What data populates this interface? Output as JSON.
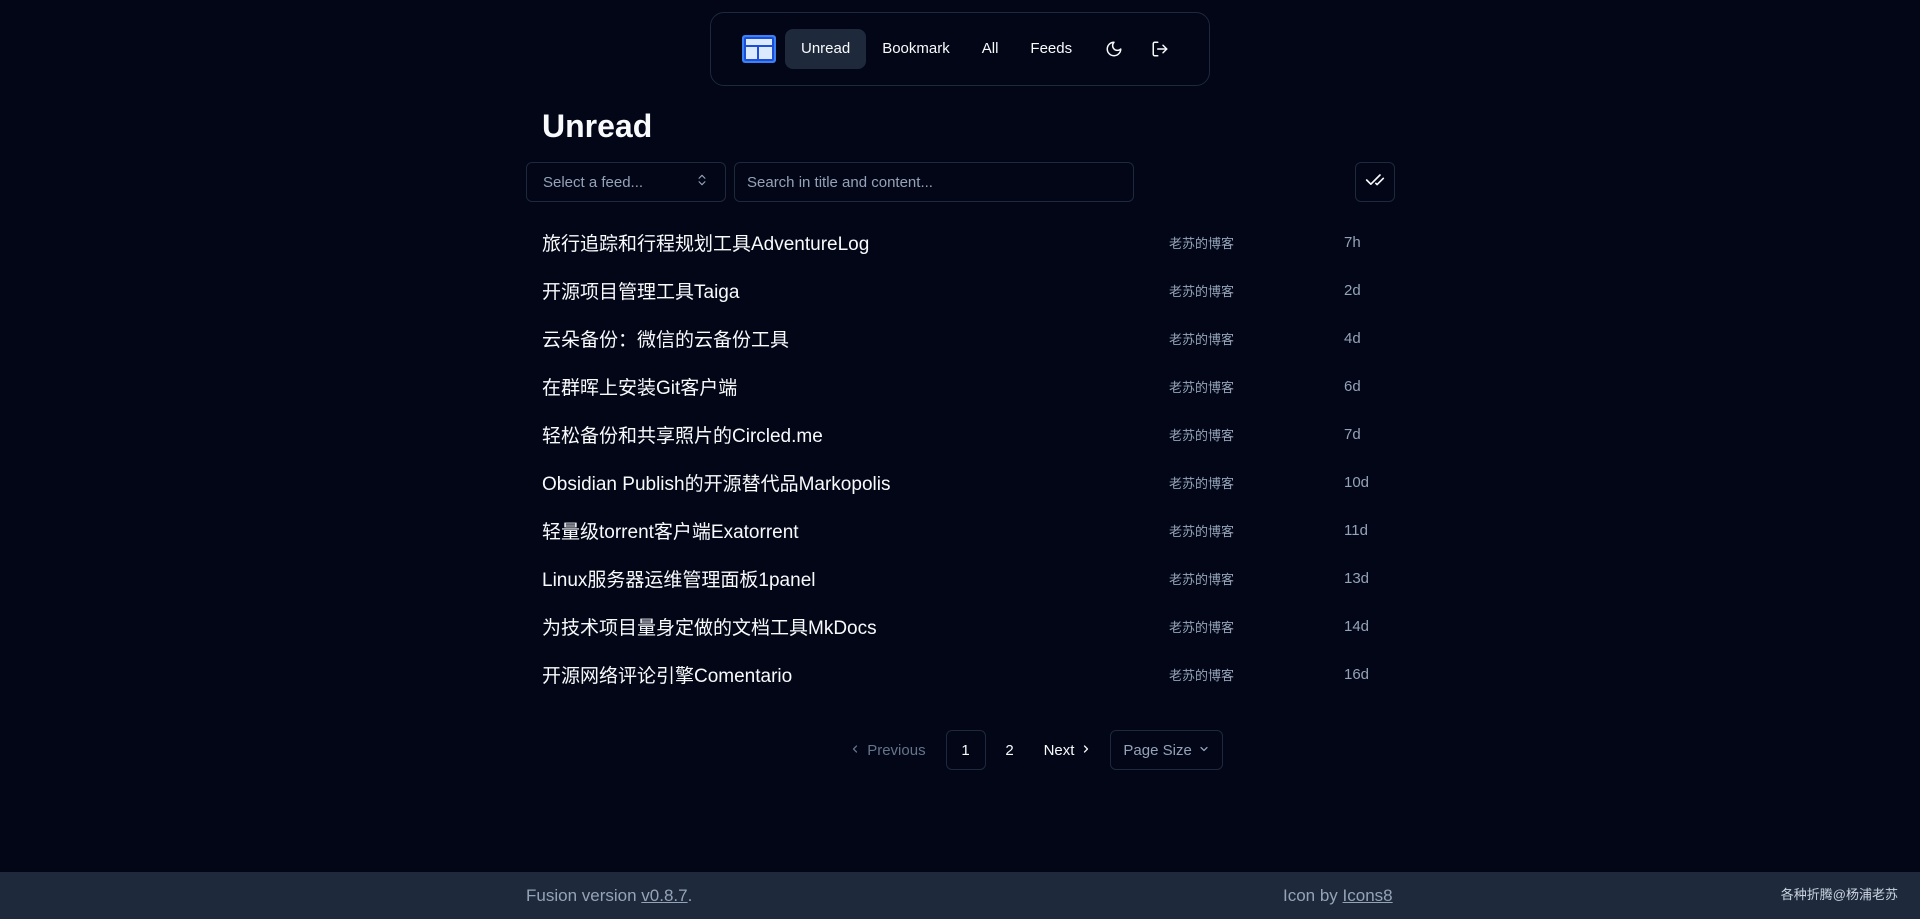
{
  "nav": {
    "items": [
      {
        "label": "Unread",
        "active": true
      },
      {
        "label": "Bookmark",
        "active": false
      },
      {
        "label": "All",
        "active": false
      },
      {
        "label": "Feeds",
        "active": false
      }
    ],
    "theme_icon": "moon-icon",
    "logout_icon": "logout-icon",
    "logo_icon": "app-logo-icon"
  },
  "page": {
    "title": "Unread"
  },
  "filters": {
    "feed_select_placeholder": "Select a feed...",
    "search_placeholder": "Search in title and content...",
    "mark_all_icon": "check-check-icon"
  },
  "items": [
    {
      "title": "旅行追踪和行程规划工具AdventureLog",
      "feed": "老苏的博客",
      "time": "7h"
    },
    {
      "title": "开源项目管理工具Taiga",
      "feed": "老苏的博客",
      "time": "2d"
    },
    {
      "title": "云朵备份：微信的云备份工具",
      "feed": "老苏的博客",
      "time": "4d"
    },
    {
      "title": "在群晖上安装Git客户端",
      "feed": "老苏的博客",
      "time": "6d"
    },
    {
      "title": "轻松备份和共享照片的Circled.me",
      "feed": "老苏的博客",
      "time": "7d"
    },
    {
      "title": "Obsidian Publish的开源替代品Markopolis",
      "feed": "老苏的博客",
      "time": "10d"
    },
    {
      "title": "轻量级torrent客户端Exatorrent",
      "feed": "老苏的博客",
      "time": "11d"
    },
    {
      "title": "Linux服务器运维管理面板1panel",
      "feed": "老苏的博客",
      "time": "13d"
    },
    {
      "title": "为技术项目量身定做的文档工具MkDocs",
      "feed": "老苏的博客",
      "time": "14d"
    },
    {
      "title": "开源网络评论引擎Comentario",
      "feed": "老苏的博客",
      "time": "16d"
    }
  ],
  "pagination": {
    "previous_label": "Previous",
    "pages": [
      "1",
      "2"
    ],
    "current_page": "1",
    "next_label": "Next",
    "page_size_label": "Page Size"
  },
  "footer": {
    "version_prefix": "Fusion version ",
    "version": "v0.8.7",
    "version_suffix": ".",
    "icon_prefix": "Icon by ",
    "icon_link": "Icons8",
    "watermark": "各种折腾@杨浦老苏"
  },
  "colors": {
    "background": "#020617",
    "border": "#1e293b",
    "muted": "#94a3b8",
    "logo_blue": "#2563eb"
  }
}
